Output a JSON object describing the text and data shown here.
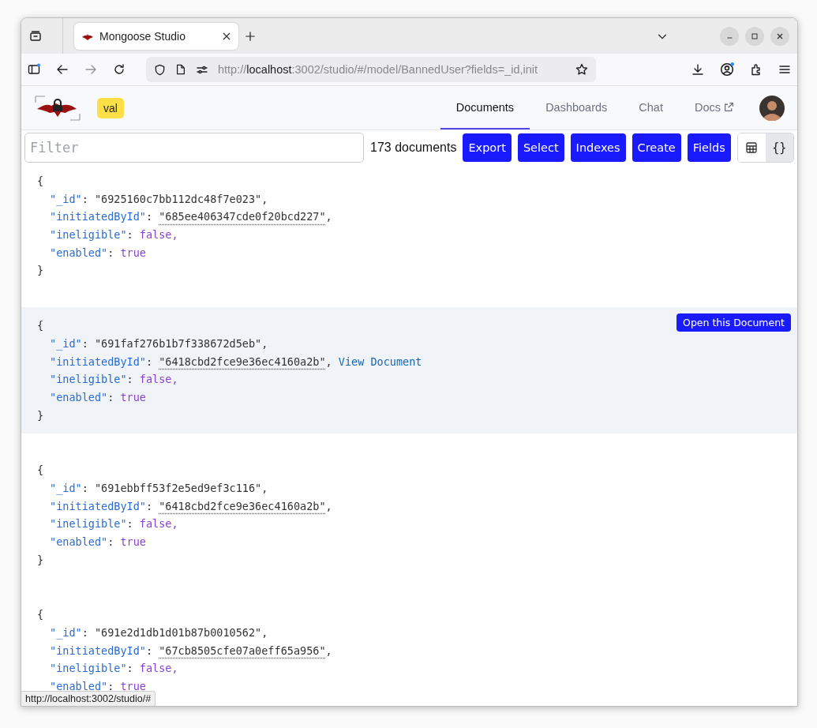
{
  "browser": {
    "tabs": [
      {
        "title": "Mongoose Studio",
        "selected": true
      }
    ],
    "url": "http://localhost:3002/studio/#/model/BannedUser?fields=_id,init",
    "status_url": "http://localhost:3002/studio/#"
  },
  "header": {
    "badge": "val",
    "nav": [
      {
        "label": "Documents",
        "selected": true,
        "external": false
      },
      {
        "label": "Dashboards",
        "selected": false,
        "external": false
      },
      {
        "label": "Chat",
        "selected": false,
        "external": false
      },
      {
        "label": "Docs",
        "selected": false,
        "external": true
      }
    ]
  },
  "toolbar": {
    "filter_placeholder": "Filter",
    "count": "173 documents",
    "buttons": [
      "Export",
      "Select",
      "Indexes",
      "Create",
      "Fields"
    ],
    "views": [
      {
        "kind": "table",
        "selected": false
      },
      {
        "kind": "json",
        "label": "{}",
        "selected": true
      }
    ]
  },
  "documents": [
    {
      "hovered": false,
      "open": "{",
      "close": "}",
      "fields": [
        {
          "kind": "string",
          "key": "\"_id\"",
          "colon": ":",
          "value": "\"6925160c7bb112dc48f7e023\"",
          "comma": ","
        },
        {
          "kind": "ref",
          "key": "\"initiatedById\"",
          "colon": ":",
          "value": "\"685ee406347cde0f20bcd227\"",
          "comma": ","
        },
        {
          "kind": "boolean",
          "key": "\"ineligible\"",
          "colon": ":",
          "value": "false,"
        },
        {
          "kind": "boolean",
          "key": "\"enabled\"",
          "colon": ":",
          "value": "true"
        }
      ]
    },
    {
      "hovered": true,
      "open_button": "Open this Document",
      "open": "{",
      "close": "}",
      "fields": [
        {
          "kind": "string",
          "key": "\"_id\"",
          "colon": ":",
          "value": "\"691faf276b1b7f338672d5eb\"",
          "comma": ","
        },
        {
          "kind": "ref",
          "key": "\"initiatedById\"",
          "colon": ":",
          "value": "\"6418cbd2fce9e36ec4160a2b\"",
          "comma": ",",
          "link": "View Document"
        },
        {
          "kind": "boolean",
          "key": "\"ineligible\"",
          "colon": ":",
          "value": "false,"
        },
        {
          "kind": "boolean",
          "key": "\"enabled\"",
          "colon": ":",
          "value": "true"
        }
      ]
    },
    {
      "hovered": false,
      "open": "{",
      "close": "}",
      "fields": [
        {
          "kind": "string",
          "key": "\"_id\"",
          "colon": ":",
          "value": "\"691ebbff53f2e5ed9ef3c116\"",
          "comma": ","
        },
        {
          "kind": "ref",
          "key": "\"initiatedById\"",
          "colon": ":",
          "value": "\"6418cbd2fce9e36ec4160a2b\"",
          "comma": ","
        },
        {
          "kind": "boolean",
          "key": "\"ineligible\"",
          "colon": ":",
          "value": "false,"
        },
        {
          "kind": "boolean",
          "key": "\"enabled\"",
          "colon": ":",
          "value": "true"
        }
      ]
    },
    {
      "hovered": false,
      "open": "{",
      "fields": [
        {
          "kind": "string",
          "key": "\"_id\"",
          "colon": ":",
          "value": "\"691e2d1db1d01b87b0010562\"",
          "comma": ","
        },
        {
          "kind": "ref",
          "key": "\"initiatedById\"",
          "colon": ":",
          "value": "\"67cb8505cfe07a0eff65a956\"",
          "comma": ","
        },
        {
          "kind": "boolean",
          "key": "\"ineligible\"",
          "colon": ":",
          "value": "false,"
        },
        {
          "kind": "boolean",
          "key": "\"enabled\"",
          "colon": ":",
          "value": "true"
        }
      ]
    }
  ]
}
